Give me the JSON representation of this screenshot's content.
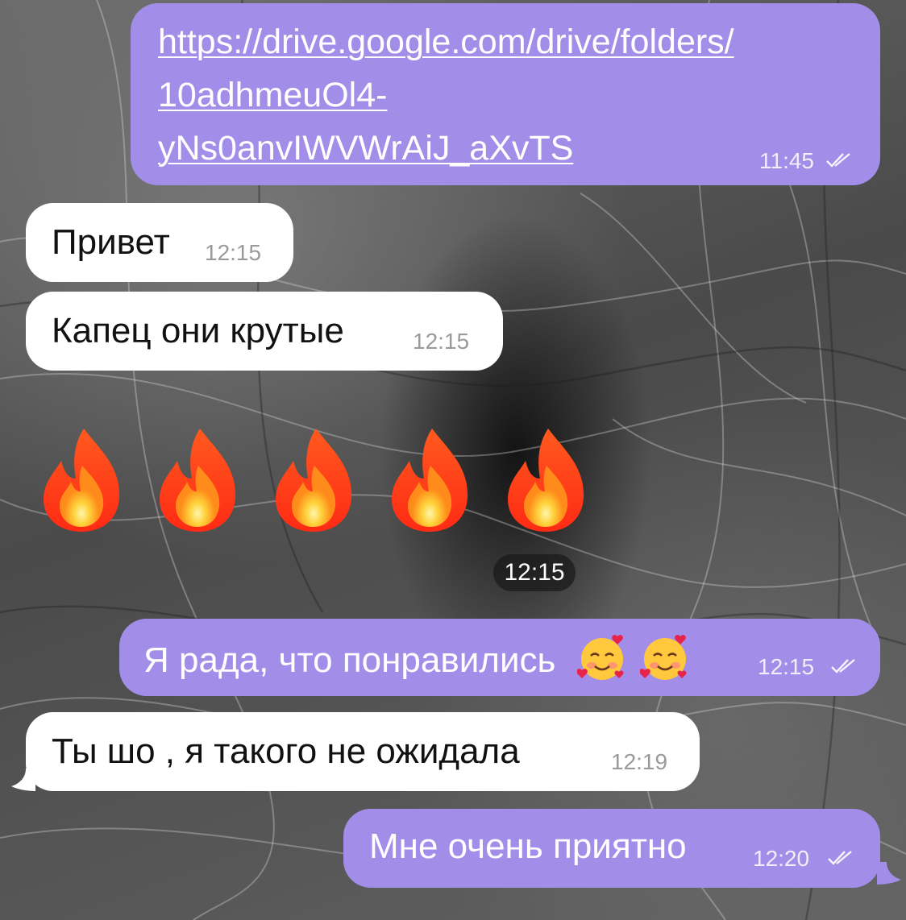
{
  "colors": {
    "outgoing_bubble": "#a28ee8",
    "incoming_bubble": "#ffffff",
    "outgoing_text": "#ffffff",
    "incoming_text": "#111111"
  },
  "messages": [
    {
      "direction": "out",
      "type": "link",
      "lines": [
        "https://drive.google.com/drive/folders/",
        "10adhmeuOl4-",
        "yNs0anvIWVWrAiJ_aXvTS"
      ],
      "time": "11:45",
      "status": "read"
    },
    {
      "direction": "in",
      "text": "Привет",
      "time": "12:15"
    },
    {
      "direction": "in",
      "text": "Капец они крутые",
      "time": "12:15"
    },
    {
      "direction": "in",
      "type": "emoji",
      "emoji": [
        "fire-icon",
        "fire-icon",
        "fire-icon",
        "fire-icon",
        "fire-icon"
      ],
      "time": "12:15"
    },
    {
      "direction": "out",
      "text": "Я рада, что понравились",
      "emoji": [
        "smiling-face-with-hearts-icon",
        "smiling-face-with-hearts-icon"
      ],
      "time": "12:15",
      "status": "read"
    },
    {
      "direction": "in",
      "text": "Ты шо , я такого не ожидала",
      "time": "12:19"
    },
    {
      "direction": "out",
      "text": "Мне очень приятно",
      "time": "12:20",
      "status": "read"
    }
  ]
}
